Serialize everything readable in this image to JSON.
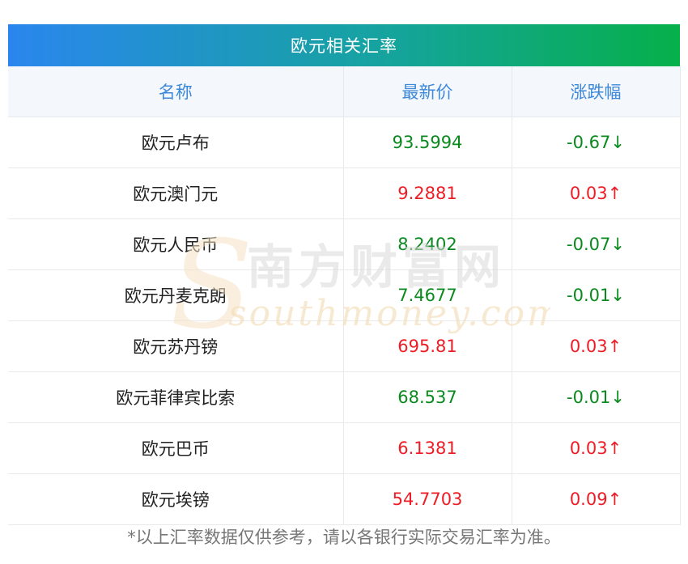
{
  "title": "欧元相关汇率",
  "columns": [
    "名称",
    "最新价",
    "涨跌幅"
  ],
  "rows": [
    {
      "name": "欧元卢布",
      "price": "93.5994",
      "change": "-0.67↓",
      "dir": "down"
    },
    {
      "name": "欧元澳门元",
      "price": "9.2881",
      "change": "0.03↑",
      "dir": "up"
    },
    {
      "name": "欧元人民币",
      "price": "8.2402",
      "change": "-0.07↓",
      "dir": "down"
    },
    {
      "name": "欧元丹麦克朗",
      "price": "7.4677",
      "change": "-0.01↓",
      "dir": "down"
    },
    {
      "name": "欧元苏丹镑",
      "price": "695.81",
      "change": "0.03↑",
      "dir": "up"
    },
    {
      "name": "欧元菲律宾比索",
      "price": "68.537",
      "change": "-0.01↓",
      "dir": "down"
    },
    {
      "name": "欧元巴币",
      "price": "6.1381",
      "change": "0.03↑",
      "dir": "up"
    },
    {
      "name": "欧元埃镑",
      "price": "54.7703",
      "change": "0.09↑",
      "dir": "up"
    }
  ],
  "watermark": {
    "brand_cn": "南方财富网",
    "brand_en": "southmoney.com"
  },
  "footer": "*以上汇率数据仅供参考，请以各银行实际交易汇率为准。",
  "colors": {
    "up": "#ee1c25",
    "down": "#0a8a1e",
    "header_text": "#3d88d8"
  }
}
